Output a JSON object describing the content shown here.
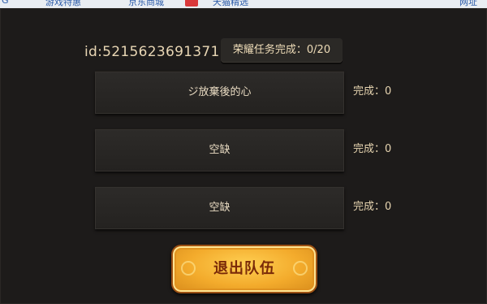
{
  "browser_bar": {
    "bookmarks": [
      "G",
      "游戏特惠",
      "京东商城",
      "天猫精选",
      "网址"
    ]
  },
  "team_panel": {
    "player_id": "id:5215623691371",
    "honor_task": "荣耀任务完成：0/20",
    "slots": [
      {
        "name": "ジ放棄後的心",
        "status": "完成：0"
      },
      {
        "name": "空缺",
        "status": "完成：0"
      },
      {
        "name": "空缺",
        "status": "完成：0"
      }
    ],
    "leave_button": "退出队伍"
  }
}
